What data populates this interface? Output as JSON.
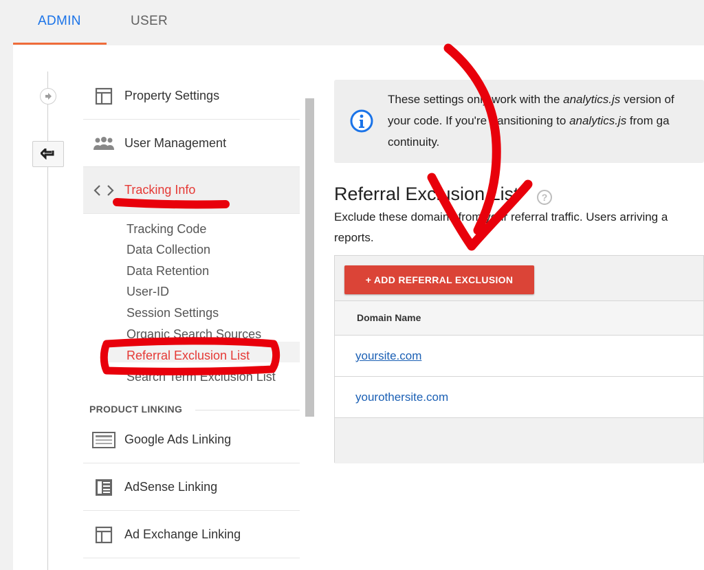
{
  "tabs": [
    {
      "label": "ADMIN",
      "active": true
    },
    {
      "label": "USER",
      "active": false
    }
  ],
  "nav": {
    "items": [
      {
        "label": "Property Settings",
        "icon": "layout-icon"
      },
      {
        "label": "User Management",
        "icon": "people-icon"
      },
      {
        "label": "Tracking Info",
        "icon": "code-icon",
        "active": true
      }
    ],
    "tracking_sub": [
      "Tracking Code",
      "Data Collection",
      "Data Retention",
      "User-ID",
      "Session Settings",
      "Organic Search Sources",
      "Referral Exclusion List",
      "Search Term Exclusion List"
    ],
    "section_label": "PRODUCT LINKING",
    "linking": [
      {
        "label": "Google Ads Linking",
        "icon": "ads-icon"
      },
      {
        "label": "AdSense Linking",
        "icon": "adsense-icon"
      },
      {
        "label": "Ad Exchange Linking",
        "icon": "layout-icon"
      }
    ]
  },
  "info": {
    "line1_pre": "These settings only work with the ",
    "line1_em": "analytics.js",
    "line1_post": " version of",
    "line2_pre": "your code. If you're transitioning to ",
    "line2_em": "analytics.js",
    "line2_post": " from ga",
    "line3": "continuity."
  },
  "main": {
    "title": "Referral Exclusion List",
    "help": "?",
    "desc_line1": "Exclude these domains from your referral traffic. Users arriving a",
    "desc_line2": "reports.",
    "add_button": "+ ADD REFERRAL EXCLUSION",
    "column_header": "Domain Name",
    "domains": [
      "yoursite.com",
      "yourothersite.com"
    ]
  },
  "annotation_color": "#e8000b",
  "accent_color": "#1a73e8"
}
